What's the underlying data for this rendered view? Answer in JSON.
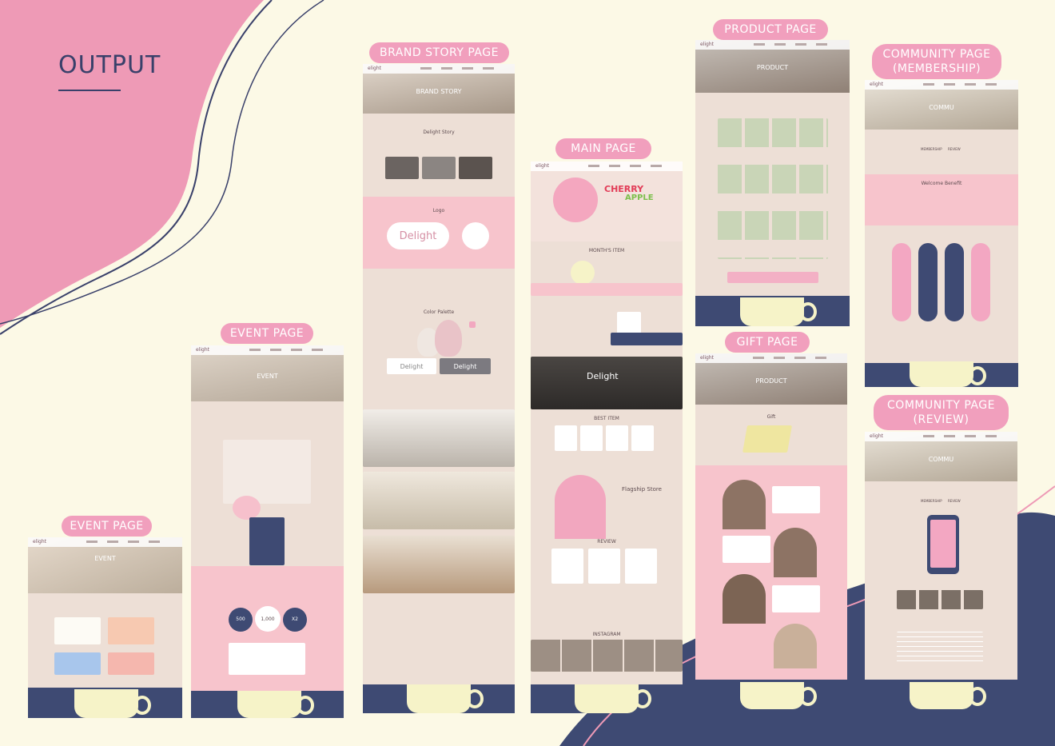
{
  "heading": "OUTPUT",
  "labels": {
    "event_small": "EVENT PAGE",
    "event_tall": "EVENT PAGE",
    "brand": "BRAND STORY PAGE",
    "main": "MAIN PAGE",
    "product": "PRODUCT PAGE",
    "gift": "GIFT PAGE",
    "membership_line1": "COMMUNITY PAGE",
    "membership_line2": "(MEMBERSHIP)",
    "review_line1": "COMMUNITY PAGE",
    "review_line2": "(REVIEW)"
  },
  "brand_logo": "elight",
  "main_logo": "elight",
  "hero_titles": {
    "brand": "BRAND STORY",
    "product": "PRODUCT",
    "gift": "PRODUCT",
    "membership": "COMMU",
    "review": "COMMU",
    "event": "EVENT"
  },
  "main_page": {
    "promo_line1": "CHERRY",
    "promo_line2": "APPLE",
    "monthly": "MONTH'S ITEM",
    "best": "BEST ITEM",
    "flagship": "Flagship Store",
    "review": "REVIEW",
    "instagram": "INSTAGRAM",
    "delight_banner": "Delight"
  },
  "brand_page": {
    "story": "Delight Story",
    "logo": "Logo",
    "color": "Color Palette",
    "logo_big": "Delight",
    "logo_small_a": "Delight",
    "logo_small_b": "Delight"
  },
  "membership_page": {
    "membership": "MEMBERSHIP",
    "review": "REVIEW",
    "welcome": "Welcome Benefit"
  },
  "review_page": {
    "membership": "MEMBERSHIP",
    "review": "REVIEW"
  },
  "gift_page": {
    "gift": "Gift"
  },
  "event_tall_page": {
    "coin1": "500",
    "coin2": "1,000",
    "coin3": "X2"
  },
  "colors": {
    "background": "#fcf9e6",
    "pink": "#f19fbd",
    "navy": "#39406a",
    "beige": "#eddfd6",
    "pink_band": "#f7c4cc",
    "footer": "#3e4a73"
  }
}
